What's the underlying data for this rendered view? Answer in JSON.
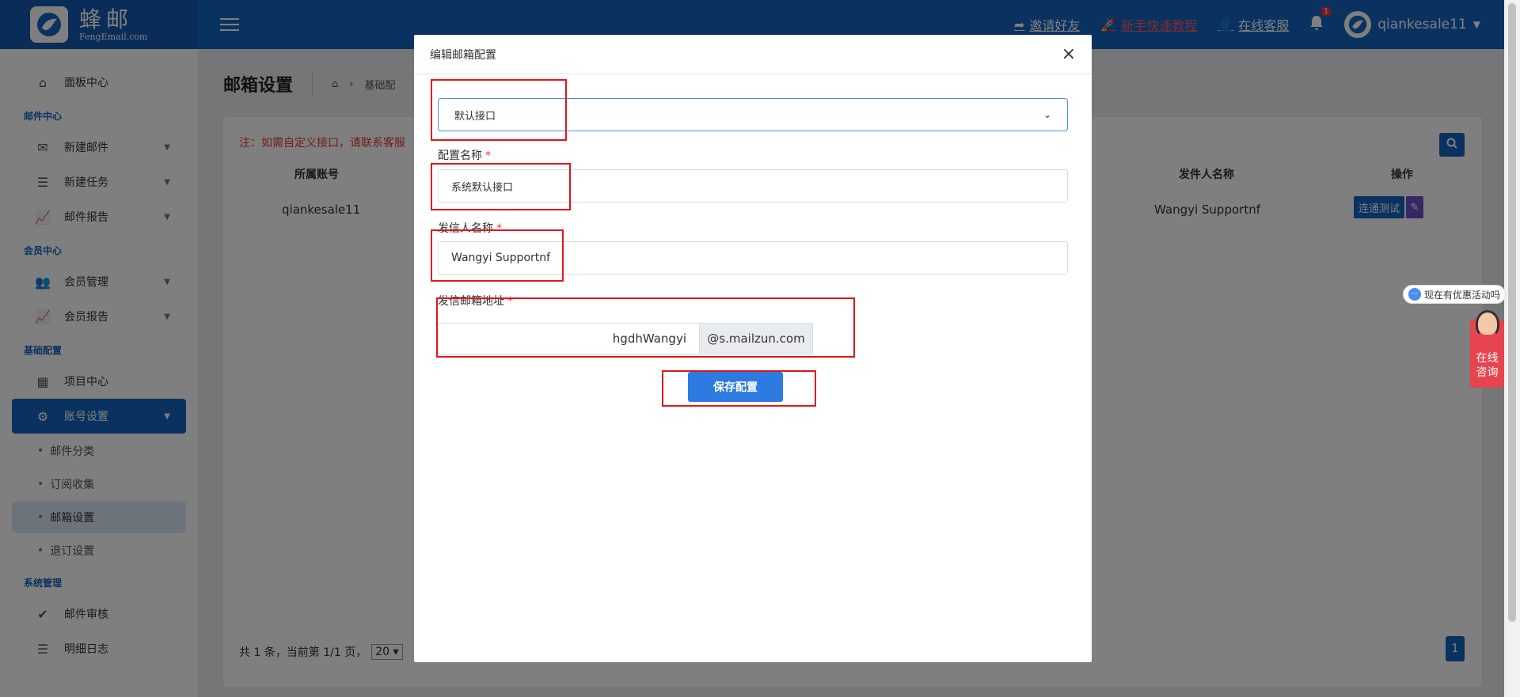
{
  "header": {
    "brand_name": "蜂邮",
    "brand_sub": "FengEmail.com",
    "links": {
      "invite": "邀请好友",
      "tutorial": "新手快速教程",
      "support": "在线客服"
    },
    "notification_count": "1",
    "username": "qiankesale11"
  },
  "sidebar": {
    "dashboard": "面板中心",
    "sections": {
      "mail": "邮件中心",
      "member": "会员中心",
      "basic": "基础配置",
      "system": "系统管理"
    },
    "items": {
      "new_mail": "新建邮件",
      "new_task": "新建任务",
      "mail_report": "邮件报告",
      "member_manage": "会员管理",
      "member_report": "会员报告",
      "project_center": "项目中心",
      "account_settings": "账号设置",
      "mail_review": "邮件审核",
      "detail_log": "明细日志"
    },
    "sub_items": [
      "邮件分类",
      "订阅收集",
      "邮箱设置",
      "退订设置"
    ]
  },
  "main": {
    "page_title": "邮箱设置",
    "breadcrumb": "基础配",
    "notice": "注：如需自定义接口，请联系客服",
    "table": {
      "headers": {
        "account": "所属账号",
        "sender_name": "发件人名称",
        "actions": "操作"
      },
      "row": {
        "account": "qiankesale11",
        "sender_name": "Wangyi Supportnf",
        "test_button": "连通测试"
      }
    },
    "pager": {
      "info": "共 1 条，当前第 1/1 页，",
      "page_size": "20",
      "current_page": "1"
    }
  },
  "modal": {
    "title": "编辑邮箱配置",
    "interface_select": "默认接口",
    "config_name_label": "配置名称",
    "config_name_value": "系统默认接口",
    "sender_name_label": "发信人名称",
    "sender_name_value": "Wangyi Supportnf",
    "email_label": "发信邮箱地址",
    "email_local": "hgdhWangyi",
    "email_domain": "@s.mailzun.com",
    "required_mark": "*",
    "save_button": "保存配置"
  },
  "widgets": {
    "promo": "现在有优惠活动吗",
    "consult_line1": "在线",
    "consult_line2": "咨询"
  },
  "colors": {
    "primary": "#1565c0",
    "danger": "#e53935",
    "annotation": "#e0161b"
  }
}
